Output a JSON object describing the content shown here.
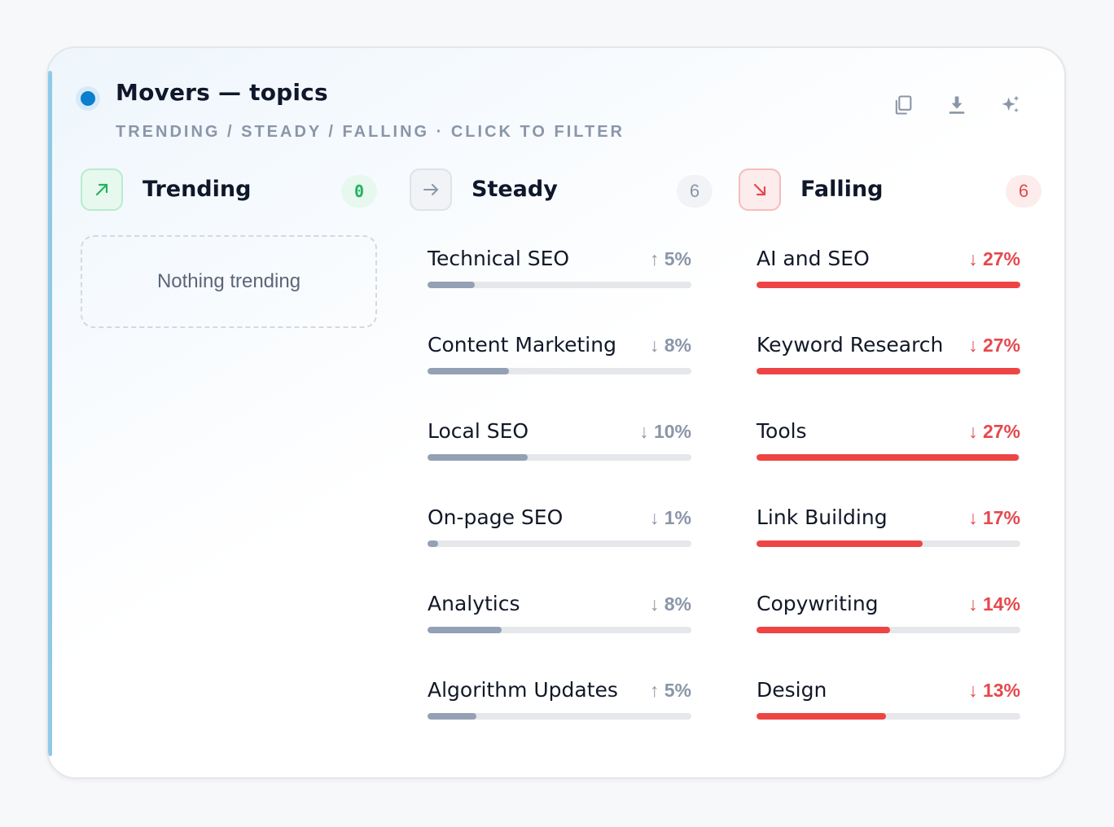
{
  "header": {
    "title": "Movers — topics",
    "subtitle": "TRENDING / STEADY / FALLING · CLICK TO FILTER",
    "accent_color": "#0b7fcd",
    "actions": [
      {
        "name": "copy",
        "icon": "copy-icon"
      },
      {
        "name": "download",
        "icon": "download-icon"
      },
      {
        "name": "ai",
        "icon": "sparkles-icon"
      }
    ]
  },
  "columns": {
    "trending": {
      "title": "Trending",
      "count": "0",
      "icon": "arrow-up-right-icon",
      "color": "#22b35e",
      "empty_text": "Nothing trending",
      "items": []
    },
    "steady": {
      "title": "Steady",
      "count": "6",
      "icon": "arrow-right-icon",
      "color": "#94a0b4",
      "items": [
        {
          "label": "Technical SEO",
          "delta": "↑ 5%",
          "level": 0.18
        },
        {
          "label": "Content Marketing",
          "delta": "↓ 8%",
          "level": 0.31
        },
        {
          "label": "Local SEO",
          "delta": "↓ 10%",
          "level": 0.38
        },
        {
          "label": "On-page SEO",
          "delta": "↓ 1%",
          "level": 0.04
        },
        {
          "label": "Analytics",
          "delta": "↓ 8%",
          "level": 0.28
        },
        {
          "label": "Algorithm Updates",
          "delta": "↑ 5%",
          "level": 0.185
        }
      ]
    },
    "falling": {
      "title": "Falling",
      "count": "6",
      "icon": "arrow-down-right-icon",
      "color": "#ee4444",
      "items": [
        {
          "label": "AI and SEO",
          "delta": "↓ 27%",
          "level": 1.0
        },
        {
          "label": "Keyword Research",
          "delta": "↓ 27%",
          "level": 1.0
        },
        {
          "label": "Tools",
          "delta": "↓ 27%",
          "level": 0.995
        },
        {
          "label": "Link Building",
          "delta": "↓ 17%",
          "level": 0.63
        },
        {
          "label": "Copywriting",
          "delta": "↓ 14%",
          "level": 0.505
        },
        {
          "label": "Design",
          "delta": "↓ 13%",
          "level": 0.49
        }
      ]
    }
  }
}
